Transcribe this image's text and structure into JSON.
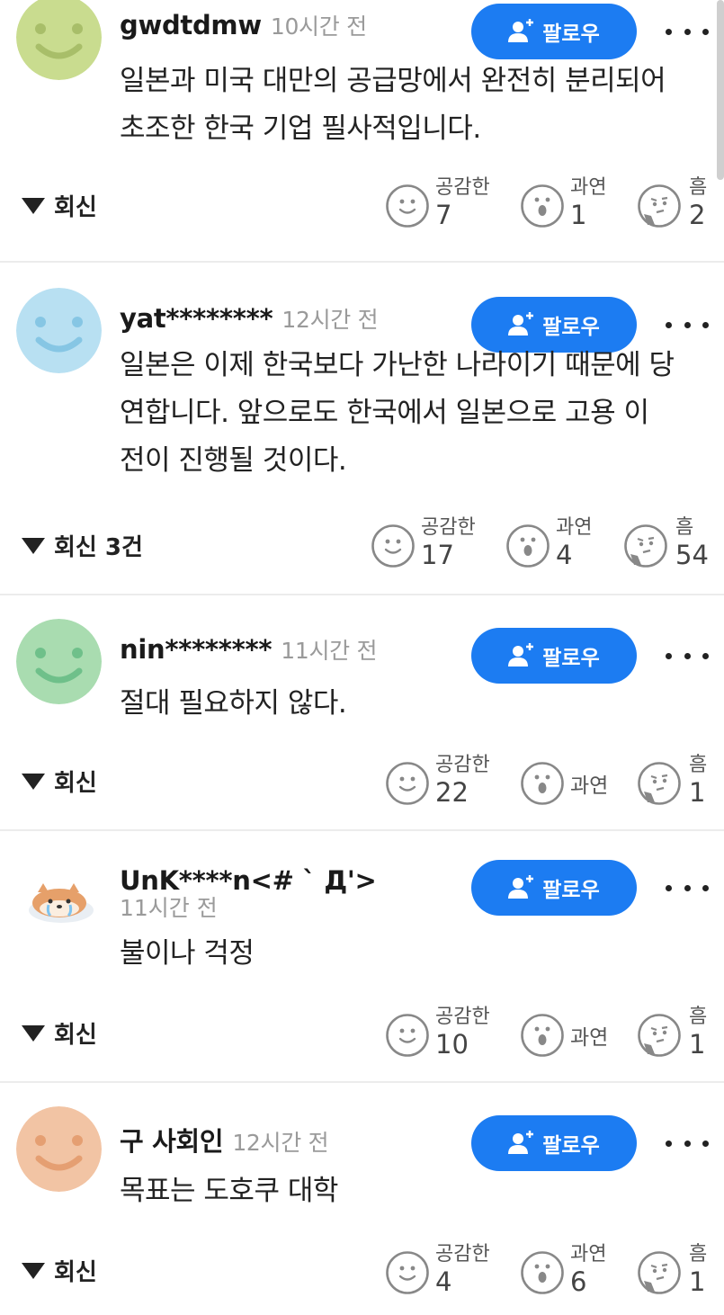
{
  "follow_label": "팔로우",
  "reactions": {
    "like_label": "공감한",
    "wow_label": "과연",
    "hmm_label": "흠"
  },
  "colors": {
    "follow_button": "#1c7cf2",
    "reaction_icon": "#888888"
  },
  "comments": [
    {
      "username": "gwdtdmw",
      "time": "10시간 전",
      "avatar": {
        "type": "smiley",
        "bg": "#c9dc8f",
        "fg": "#a8be69"
      },
      "text": [
        "일본과 미국 대만의 공급망에서 완전히 분리되어",
        "초조한 한국 기업 필사적입니다."
      ],
      "reply_label": "회신",
      "like": "7",
      "wow": "1",
      "hmm": "2"
    },
    {
      "username": "yat********",
      "time": "12시간 전",
      "avatar": {
        "type": "smiley",
        "bg": "#b8e0f2",
        "fg": "#86c6e4"
      },
      "text": [
        "일본은 이제 한국보다 가난한 나라이기 때문에 당",
        "연합니다. 앞으로도 한국에서 일본으로 고용 이",
        "전이 진행될 것이다."
      ],
      "reply_label": "회신 3건",
      "like": "17",
      "wow": "4",
      "hmm": "54"
    },
    {
      "username": "nin********",
      "time": "11시간 전",
      "avatar": {
        "type": "smiley",
        "bg": "#a9dcb0",
        "fg": "#6fc08a"
      },
      "text": [
        "절대 필요하지 않다."
      ],
      "reply_label": "회신",
      "like": "22",
      "wow": "",
      "hmm": "1"
    },
    {
      "username": "UnK****n<# ` Д'>",
      "time": "11시간 전",
      "avatar": {
        "type": "dog",
        "bg": "#ffffff",
        "fg": "#e6a06a"
      },
      "text": [
        "불이나 걱정"
      ],
      "reply_label": "회신",
      "like": "10",
      "wow": "",
      "hmm": "1"
    },
    {
      "username": "구 사회인",
      "time": "12시간 전",
      "avatar": {
        "type": "smiley",
        "bg": "#f2c4a4",
        "fg": "#e59f72"
      },
      "text": [
        "목표는 도호쿠 대학"
      ],
      "reply_label": "회신",
      "like": "4",
      "wow": "6",
      "hmm": "1"
    }
  ]
}
